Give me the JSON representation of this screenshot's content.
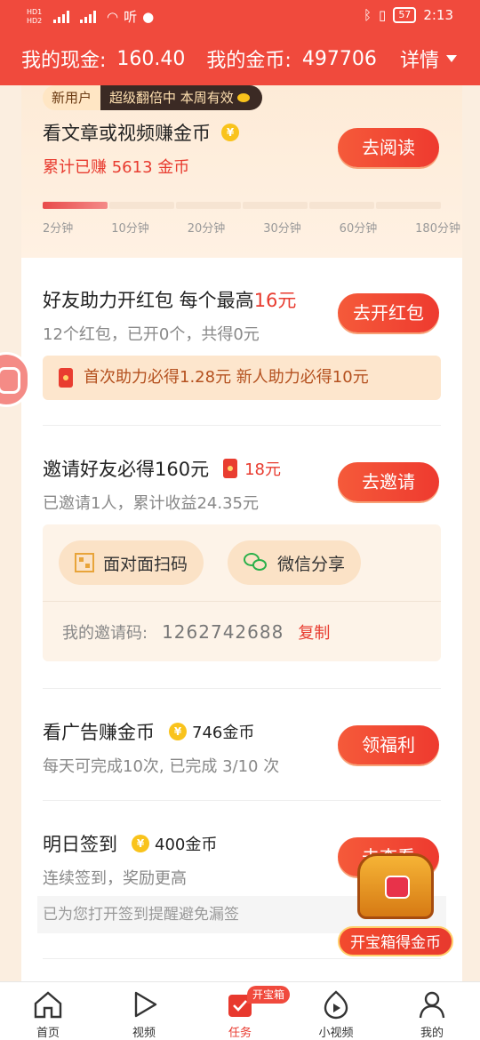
{
  "status_bar": {
    "listen": "听",
    "battery": "57",
    "time": "2:13"
  },
  "header": {
    "cash_label": "我的现金:",
    "cash_value": "160.40",
    "coins_label": "我的金币:",
    "coins_value": "497706",
    "detail_label": "详情"
  },
  "read_task": {
    "badge_new": "新用户",
    "badge_promo": "超级翻倍中 本周有效",
    "title": "看文章或视频赚金币",
    "earned": "累计已赚 5613 金币",
    "button": "去阅读",
    "progress_fraction": 0.1667,
    "ticks": [
      "2分钟",
      "10分钟",
      "20分钟",
      "30分钟",
      "60分钟",
      "180分钟"
    ]
  },
  "redpacket_task": {
    "title_prefix": "好友助力开红包 每个最高",
    "title_amount": "16元",
    "subtitle": "12个红包，已开0个，共得0元",
    "button": "去开红包",
    "banner": "首次助力必得1.28元 新人助力必得10元"
  },
  "invite_task": {
    "title": "邀请好友必得160元",
    "reward": "18元",
    "subtitle": "已邀请1人，累计收益24.35元",
    "button": "去邀请",
    "scan_label": "面对面扫码",
    "wechat_label": "微信分享",
    "code_label": "我的邀请码:",
    "code_value": "1262742688",
    "copy_label": "复制"
  },
  "ad_task": {
    "title": "看广告赚金币",
    "coins": "746金币",
    "subtitle": "每天可完成10次, 已完成 3/10 次",
    "button": "领福利"
  },
  "signin_task": {
    "title": "明日签到",
    "coins": "400金币",
    "subtitle": "连续签到，奖励更高",
    "button": "去查看",
    "reminder": "已为您打开签到提醒避免漏签"
  },
  "treasure": {
    "label": "开宝箱得金币"
  },
  "nav": {
    "home": "首页",
    "video": "视频",
    "task": "任务",
    "task_tag": "开宝箱",
    "short_video": "小视频",
    "me": "我的"
  },
  "colors": {
    "brand_red": "#f04a3d",
    "coin_gold": "#f9c31c"
  }
}
